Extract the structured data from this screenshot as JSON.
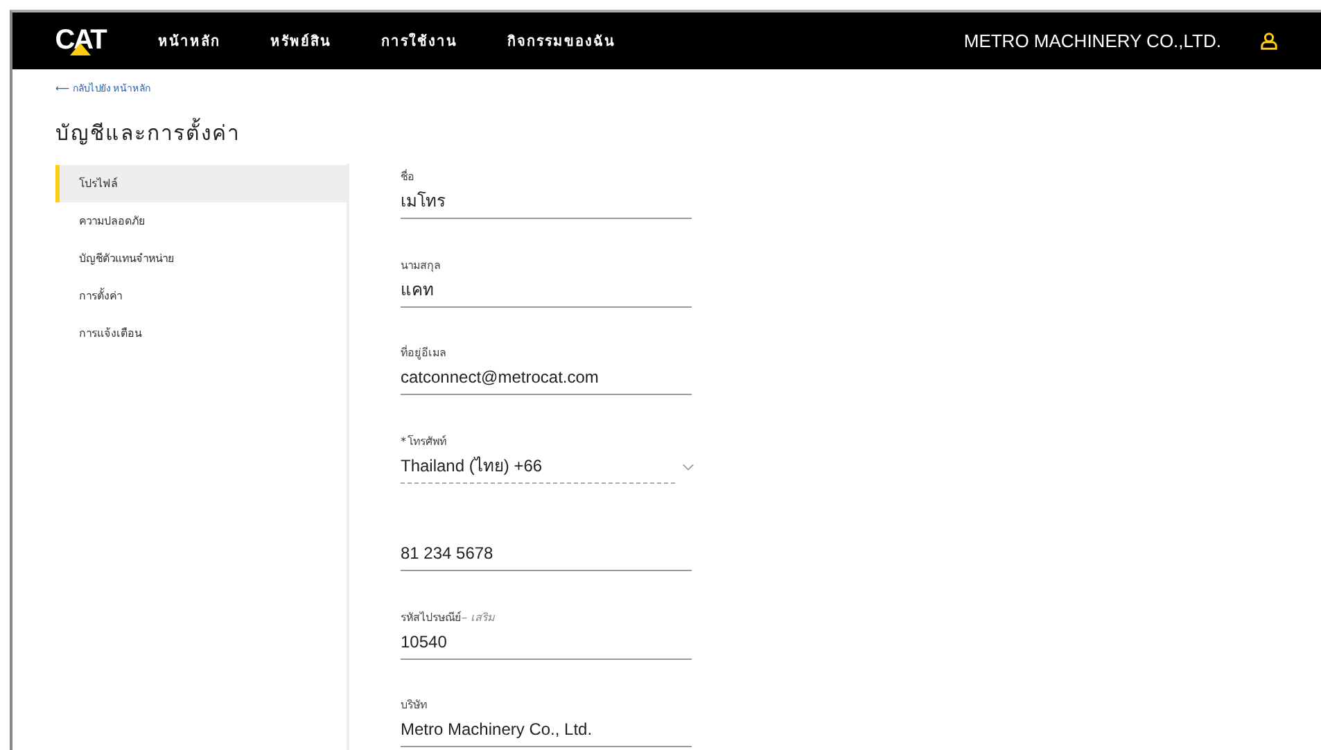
{
  "header": {
    "logo": "CAT",
    "nav": [
      {
        "label": "หน้าหลัก"
      },
      {
        "label": "หรัพย์สิน"
      },
      {
        "label": "การใช้งาน"
      },
      {
        "label": "กิจกรรมของฉัน"
      }
    ],
    "company": "METRO MACHINERY CO.,LTD."
  },
  "back_link": {
    "arrow": "⟵",
    "label": "กลับไปยัง หน้าหลัก"
  },
  "page_title": "บัญชีและการตั้งค่า",
  "sidebar": {
    "items": [
      {
        "label": "โปรไฟล์",
        "selected": true
      },
      {
        "label": "ความปลอดภัย",
        "selected": false
      },
      {
        "label": "บัญชีตัวแทนจำหน่าย",
        "selected": false
      },
      {
        "label": "การตั้งค่า",
        "selected": false
      },
      {
        "label": "การแจ้งเตือน",
        "selected": false
      }
    ]
  },
  "form": {
    "fields": [
      {
        "kind": "text",
        "label": "ชื่อ",
        "value": "เมโทร"
      },
      {
        "kind": "text",
        "label": "นามสกุล",
        "value": "แคท"
      },
      {
        "kind": "text",
        "label": "ที่อยู่อีเมล",
        "value": "catconnect@metrocat.com"
      },
      {
        "kind": "select",
        "label": "โทรศัพท์",
        "required_mark": "*",
        "value": "Thailand (ไทย) +66"
      },
      {
        "kind": "text",
        "value": "81 234 5678"
      },
      {
        "kind": "text",
        "label": "รหัสไปรษณีย์",
        "optional_note": "– เสริม",
        "value": "10540"
      },
      {
        "kind": "text",
        "label": "บริษัท",
        "value": "Metro Machinery Co., Ltd."
      }
    ]
  }
}
